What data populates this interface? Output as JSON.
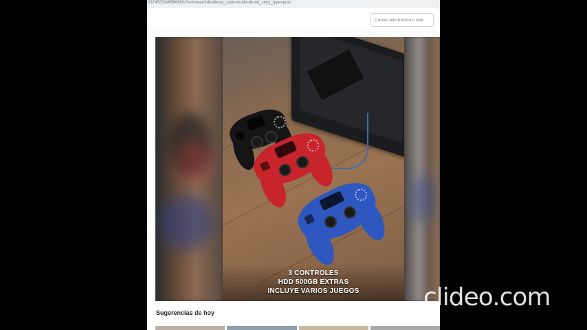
{
  "browser": {
    "url": "0374525246586650/?ref=search&referral_code=null&referral_story_type=post"
  },
  "header": {
    "email_placeholder": "Correo electrónico o telé"
  },
  "post": {
    "caption_lines": [
      "3 CONTROLES",
      "HDD 500GB EXTRAS",
      "INCLUYE VARIOS JUEGOS"
    ],
    "controller_colors": [
      "#151517",
      "#c8242c",
      "#2f57c0"
    ]
  },
  "section": {
    "suggestions_title": "Sugerencias de hoy"
  },
  "watermark": {
    "text": "clideo.com"
  }
}
